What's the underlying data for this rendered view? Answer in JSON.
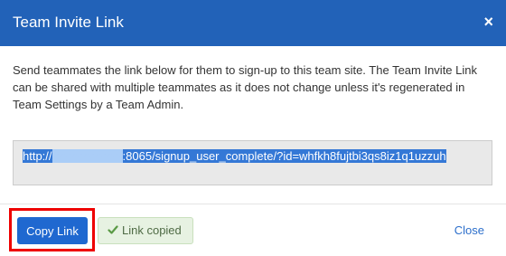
{
  "dialog": {
    "title": "Team Invite Link",
    "close_icon": "×",
    "description": "Send teammates the link below for them to sign-up to this team site. The Team Invite Link can be shared with multiple teammates as it does not change unless it's regenerated in Team Settings by a Team Admin.",
    "link": {
      "prefix": "http://",
      "redacted": "xxxxxxxxxxxx",
      "suffix": ":8065/signup_user_complete/?id=whfkh8fujtbi3qs8iz1q1uzzuh"
    }
  },
  "footer": {
    "copy_button_label": "Copy Link",
    "copied_label": "Link copied",
    "copied_icon": "check-icon",
    "close_label": "Close"
  },
  "colors": {
    "header_bg": "#2262b8",
    "primary_button": "#1f68d0",
    "highlight_border": "#ee0000",
    "success_bg": "#e7f2e2",
    "link": "#2c6fcb"
  }
}
